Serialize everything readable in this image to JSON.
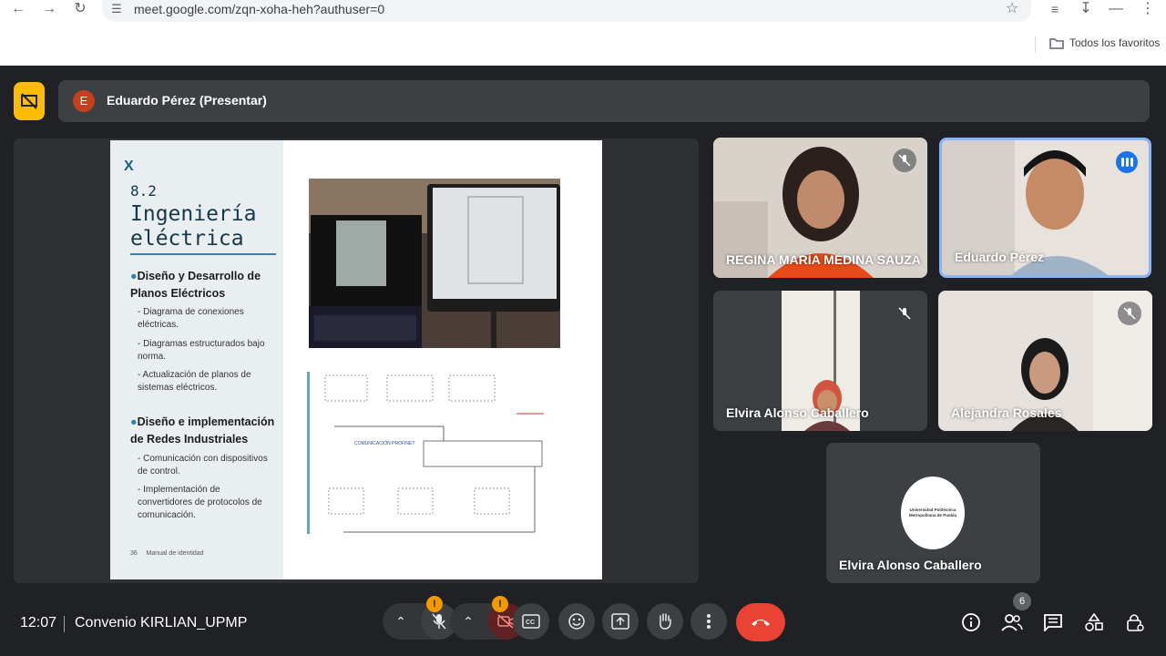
{
  "browser": {
    "url": "meet.google.com/zqn-xoha-heh?authuser=0",
    "bookmarks_label": "Todos los favoritos"
  },
  "presenter": {
    "avatar_letter": "E",
    "label": "Eduardo Pérez (Presentar)",
    "avatar_color": "#c5401f"
  },
  "slide": {
    "logo": "X",
    "section_number": "8.2",
    "title": "Ingeniería eléctrica",
    "bullets": [
      {
        "heading": "Diseño y Desarrollo de Planos Eléctricos",
        "items": [
          "- Diagrama de conexiones eléctricas.",
          "- Diagramas estructurados bajo norma.",
          "- Actualización de planos de sistemas eléctricos."
        ]
      },
      {
        "heading": "Diseño e implementación de Redes Industriales",
        "items": [
          "- Comunicación con dispositivos de control.",
          "- Implementación de convertidores de protocolos de comunicación."
        ]
      }
    ],
    "footer_page": "36",
    "footer_text": "Manual de identidad",
    "diagram_label": "COMUNICACIÓN PROFINET"
  },
  "participants": [
    {
      "name": "REGINA MARÍA MÉDINA SAUZA",
      "muted": true
    },
    {
      "name": "Eduardo Pérez",
      "speaking": true
    },
    {
      "name": "Elvira Alonso Caballero",
      "muted": true
    },
    {
      "name": "Alejandra Rosales",
      "muted": true
    },
    {
      "name": "Elvira Alonso Caballero",
      "logo_text": "Universidad Politécnica Metropolitana de Puebla"
    }
  ],
  "bottom_bar": {
    "time": "12:07",
    "meeting_name": "Convenio KIRLIAN_UPMP",
    "warning_mark": "!",
    "people_count": "6"
  },
  "icons": [
    "back-icon",
    "forward-icon",
    "reload-icon",
    "site-info-icon",
    "star-icon",
    "reading-list-icon",
    "download-icon",
    "minimize-icon",
    "menu-icon",
    "folder-icon",
    "present-icon",
    "mic-off-icon",
    "camera-off-icon",
    "captions-icon",
    "emoji-icon",
    "present-screen-icon",
    "raise-hand-icon",
    "more-icon",
    "end-call-icon",
    "info-icon",
    "people-icon",
    "chat-icon",
    "activities-icon",
    "host-controls-icon"
  ],
  "colors": {
    "end_call": "#ea4335",
    "warning": "#f29900",
    "active_speaker": "#1a73e8",
    "pin": "#fbbc04"
  }
}
